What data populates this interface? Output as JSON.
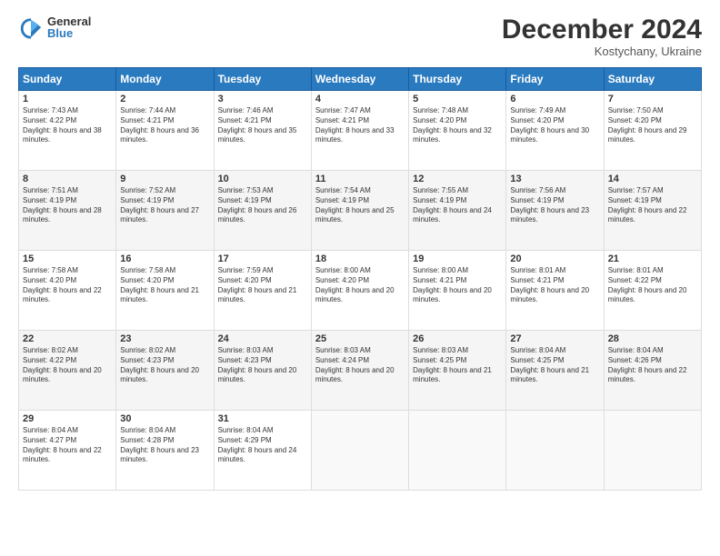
{
  "header": {
    "logo": {
      "general": "General",
      "blue": "Blue"
    },
    "title": "December 2024",
    "location": "Kostychany, Ukraine"
  },
  "weekdays": [
    "Sunday",
    "Monday",
    "Tuesday",
    "Wednesday",
    "Thursday",
    "Friday",
    "Saturday"
  ],
  "weeks": [
    [
      {
        "day": "1",
        "sunrise": "7:43 AM",
        "sunset": "4:22 PM",
        "daylight": "8 hours and 38 minutes."
      },
      {
        "day": "2",
        "sunrise": "7:44 AM",
        "sunset": "4:21 PM",
        "daylight": "8 hours and 36 minutes."
      },
      {
        "day": "3",
        "sunrise": "7:46 AM",
        "sunset": "4:21 PM",
        "daylight": "8 hours and 35 minutes."
      },
      {
        "day": "4",
        "sunrise": "7:47 AM",
        "sunset": "4:21 PM",
        "daylight": "8 hours and 33 minutes."
      },
      {
        "day": "5",
        "sunrise": "7:48 AM",
        "sunset": "4:20 PM",
        "daylight": "8 hours and 32 minutes."
      },
      {
        "day": "6",
        "sunrise": "7:49 AM",
        "sunset": "4:20 PM",
        "daylight": "8 hours and 30 minutes."
      },
      {
        "day": "7",
        "sunrise": "7:50 AM",
        "sunset": "4:20 PM",
        "daylight": "8 hours and 29 minutes."
      }
    ],
    [
      {
        "day": "8",
        "sunrise": "7:51 AM",
        "sunset": "4:19 PM",
        "daylight": "8 hours and 28 minutes."
      },
      {
        "day": "9",
        "sunrise": "7:52 AM",
        "sunset": "4:19 PM",
        "daylight": "8 hours and 27 minutes."
      },
      {
        "day": "10",
        "sunrise": "7:53 AM",
        "sunset": "4:19 PM",
        "daylight": "8 hours and 26 minutes."
      },
      {
        "day": "11",
        "sunrise": "7:54 AM",
        "sunset": "4:19 PM",
        "daylight": "8 hours and 25 minutes."
      },
      {
        "day": "12",
        "sunrise": "7:55 AM",
        "sunset": "4:19 PM",
        "daylight": "8 hours and 24 minutes."
      },
      {
        "day": "13",
        "sunrise": "7:56 AM",
        "sunset": "4:19 PM",
        "daylight": "8 hours and 23 minutes."
      },
      {
        "day": "14",
        "sunrise": "7:57 AM",
        "sunset": "4:19 PM",
        "daylight": "8 hours and 22 minutes."
      }
    ],
    [
      {
        "day": "15",
        "sunrise": "7:58 AM",
        "sunset": "4:20 PM",
        "daylight": "8 hours and 22 minutes."
      },
      {
        "day": "16",
        "sunrise": "7:58 AM",
        "sunset": "4:20 PM",
        "daylight": "8 hours and 21 minutes."
      },
      {
        "day": "17",
        "sunrise": "7:59 AM",
        "sunset": "4:20 PM",
        "daylight": "8 hours and 21 minutes."
      },
      {
        "day": "18",
        "sunrise": "8:00 AM",
        "sunset": "4:20 PM",
        "daylight": "8 hours and 20 minutes."
      },
      {
        "day": "19",
        "sunrise": "8:00 AM",
        "sunset": "4:21 PM",
        "daylight": "8 hours and 20 minutes."
      },
      {
        "day": "20",
        "sunrise": "8:01 AM",
        "sunset": "4:21 PM",
        "daylight": "8 hours and 20 minutes."
      },
      {
        "day": "21",
        "sunrise": "8:01 AM",
        "sunset": "4:22 PM",
        "daylight": "8 hours and 20 minutes."
      }
    ],
    [
      {
        "day": "22",
        "sunrise": "8:02 AM",
        "sunset": "4:22 PM",
        "daylight": "8 hours and 20 minutes."
      },
      {
        "day": "23",
        "sunrise": "8:02 AM",
        "sunset": "4:23 PM",
        "daylight": "8 hours and 20 minutes."
      },
      {
        "day": "24",
        "sunrise": "8:03 AM",
        "sunset": "4:23 PM",
        "daylight": "8 hours and 20 minutes."
      },
      {
        "day": "25",
        "sunrise": "8:03 AM",
        "sunset": "4:24 PM",
        "daylight": "8 hours and 20 minutes."
      },
      {
        "day": "26",
        "sunrise": "8:03 AM",
        "sunset": "4:25 PM",
        "daylight": "8 hours and 21 minutes."
      },
      {
        "day": "27",
        "sunrise": "8:04 AM",
        "sunset": "4:25 PM",
        "daylight": "8 hours and 21 minutes."
      },
      {
        "day": "28",
        "sunrise": "8:04 AM",
        "sunset": "4:26 PM",
        "daylight": "8 hours and 22 minutes."
      }
    ],
    [
      {
        "day": "29",
        "sunrise": "8:04 AM",
        "sunset": "4:27 PM",
        "daylight": "8 hours and 22 minutes."
      },
      {
        "day": "30",
        "sunrise": "8:04 AM",
        "sunset": "4:28 PM",
        "daylight": "8 hours and 23 minutes."
      },
      {
        "day": "31",
        "sunrise": "8:04 AM",
        "sunset": "4:29 PM",
        "daylight": "8 hours and 24 minutes."
      },
      null,
      null,
      null,
      null
    ]
  ],
  "labels": {
    "sunrise": "Sunrise:",
    "sunset": "Sunset:",
    "daylight": "Daylight:"
  }
}
